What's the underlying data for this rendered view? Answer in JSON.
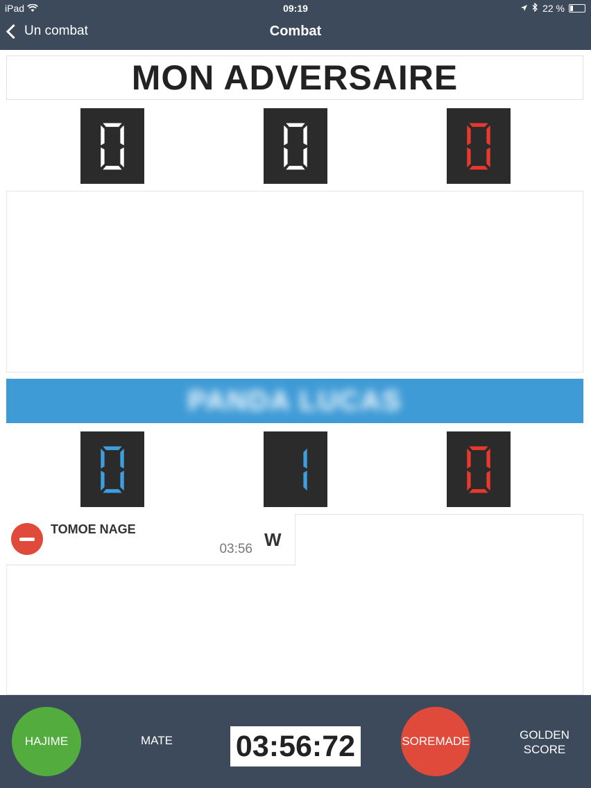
{
  "status_bar": {
    "device": "iPad",
    "time": "09:19",
    "battery": "22 %"
  },
  "nav": {
    "back_label": "Un combat",
    "title": "Combat"
  },
  "opponent": {
    "name": "MON ADVERSAIRE",
    "scores": [
      "0",
      "0",
      "0"
    ]
  },
  "player": {
    "name": "PANDA LUCAS",
    "scores": [
      "0",
      "1",
      "0"
    ]
  },
  "events": [
    {
      "name": "TOMOE NAGE",
      "time": "03:56",
      "code": "W"
    }
  ],
  "controls": {
    "hajime": "HAJIME",
    "mate": "MATE",
    "timer": "03:56:72",
    "soremade": "SOREMADE",
    "golden_line1": "GOLDEN",
    "golden_line2": "SCORE"
  },
  "colors": {
    "bar": "#3d4a5b",
    "white_digit": "#ffffff",
    "blue_digit": "#3d9ee0",
    "red_digit": "#e8392c",
    "player_band": "#3f9bd6",
    "hajime": "#53ac3e",
    "soremade": "#e04a3a"
  },
  "icons": {
    "back": "chevron-left-icon",
    "wifi": "wifi-icon",
    "location": "location-arrow-icon",
    "bluetooth": "bluetooth-icon",
    "battery": "battery-icon",
    "delete": "minus-circle-icon"
  }
}
